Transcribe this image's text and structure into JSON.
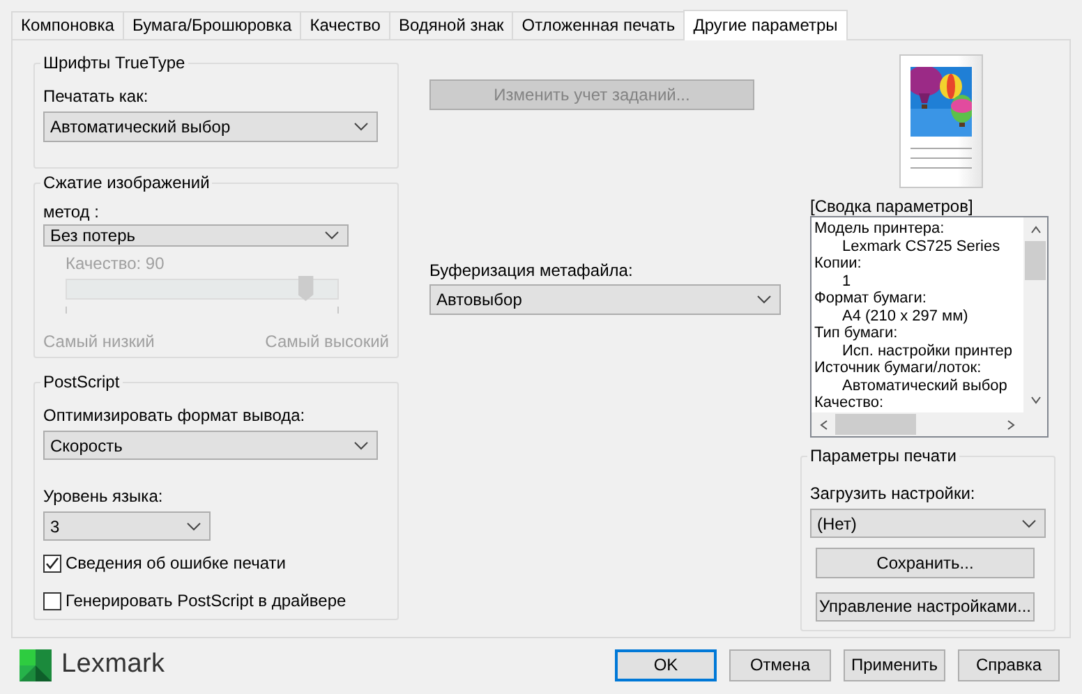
{
  "tabs": [
    {
      "label": "Компоновка",
      "selected": false
    },
    {
      "label": "Бумага/Брошюровка",
      "selected": false
    },
    {
      "label": "Качество",
      "selected": false
    },
    {
      "label": "Водяной знак",
      "selected": false
    },
    {
      "label": "Отложенная печать",
      "selected": false
    },
    {
      "label": "Другие параметры",
      "selected": true
    }
  ],
  "truetype": {
    "title": "Шрифты TrueType",
    "label": "Печатать как:",
    "value": "Автоматический выбор"
  },
  "compression": {
    "title": "Сжатие изображений",
    "label": "метод :",
    "value": "Без потерь",
    "quality": {
      "label": "Качество: 90",
      "level": 0.88,
      "disabled": true,
      "min_label": "Самый низкий",
      "max_label": "Самый высокий"
    }
  },
  "postscript": {
    "title": "PostScript",
    "optimize_label": "Оптимизировать формат вывода:",
    "optimize_value": "Скорость",
    "level_label": "Уровень языка:",
    "level_value": "3",
    "checkboxes": [
      {
        "label": "Сведения об ошибке печати",
        "checked": true
      },
      {
        "label": "Генерировать PostScript в драйвере",
        "checked": false
      }
    ]
  },
  "job_accounting_button": {
    "label": "Изменить учет заданий...",
    "disabled": true
  },
  "metafile": {
    "label": "Буферизация метафайла:",
    "value": "Автовыбор"
  },
  "summary": {
    "title": "[Сводка параметров]",
    "lines": [
      {
        "text": "Модель принтера:",
        "kind": "heading"
      },
      {
        "text": "Lexmark CS725 Series",
        "kind": "value"
      },
      {
        "text": "Копии:",
        "kind": "heading"
      },
      {
        "text": "1",
        "kind": "value"
      },
      {
        "text": "Формат бумаги:",
        "kind": "heading"
      },
      {
        "text": "A4 (210 x 297 мм)",
        "kind": "value"
      },
      {
        "text": "Тип бумаги:",
        "kind": "heading"
      },
      {
        "text": "Исп. настройки принтер",
        "kind": "value"
      },
      {
        "text": "Источник бумаги/лоток:",
        "kind": "heading"
      },
      {
        "text": "Автоматический выбор",
        "kind": "value"
      },
      {
        "text": "Качество:",
        "kind": "heading"
      }
    ]
  },
  "print_presets": {
    "title": "Параметры печати",
    "label": "Загрузить настройки:",
    "value": "(Нет)",
    "buttons": [
      "Сохранить...",
      "Управление настройками..."
    ]
  },
  "brand": "Lexmark",
  "buttons": [
    {
      "label": "OK",
      "default": true
    },
    {
      "label": "Отмена",
      "default": false
    },
    {
      "label": "Применить",
      "default": false
    },
    {
      "label": "Справка",
      "default": false
    }
  ]
}
